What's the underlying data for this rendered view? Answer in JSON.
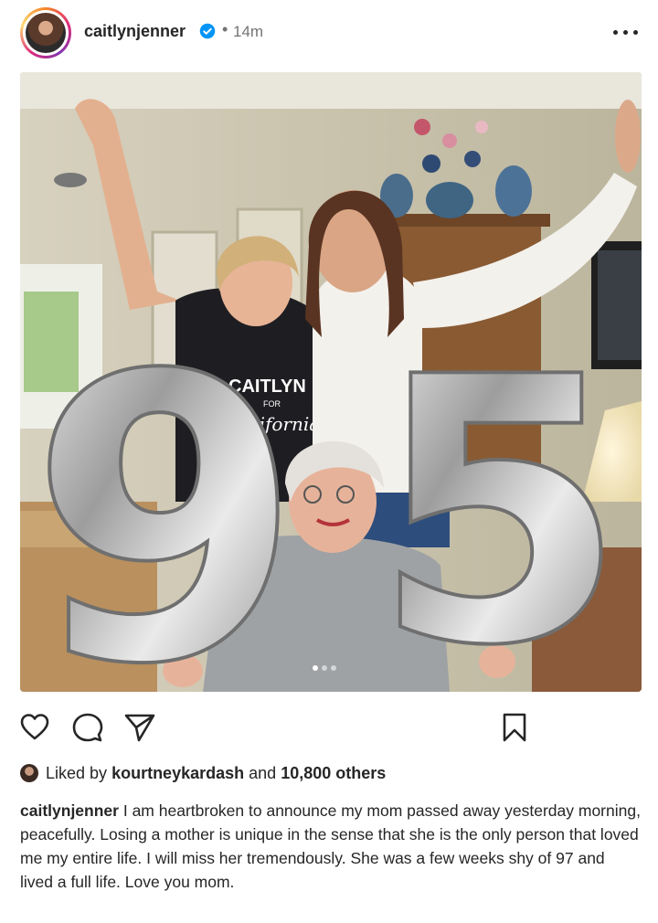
{
  "post": {
    "username": "caitlynjenner",
    "time_separator": "•",
    "time": "14m",
    "verified_icon": "verified-badge-icon",
    "more_icon": "more-options-icon"
  },
  "photo": {
    "balloon_digits": [
      "9",
      "5"
    ],
    "shirt_text": [
      "CAITLYN",
      "FOR",
      "California"
    ],
    "carousel_count": 3,
    "carousel_active": 1
  },
  "actions": {
    "like_icon": "heart-icon",
    "comment_icon": "comment-icon",
    "share_icon": "send-icon",
    "save_icon": "bookmark-icon"
  },
  "likes": {
    "prefix": "Liked by",
    "user": "kourtneykardash",
    "connector": "and",
    "others": "10,800 others"
  },
  "caption": {
    "username": "caitlynjenner",
    "text": "I am heartbroken to announce my mom passed away yesterday morning, peacefully. Losing a mother is unique in the sense that she is the only person that loved me my entire life. I will miss her tremendously. She was a few weeks shy of 97 and lived a full life. Love you mom."
  },
  "colors": {
    "text": "#262626",
    "muted": "#737373",
    "verified": "#0095f6"
  }
}
